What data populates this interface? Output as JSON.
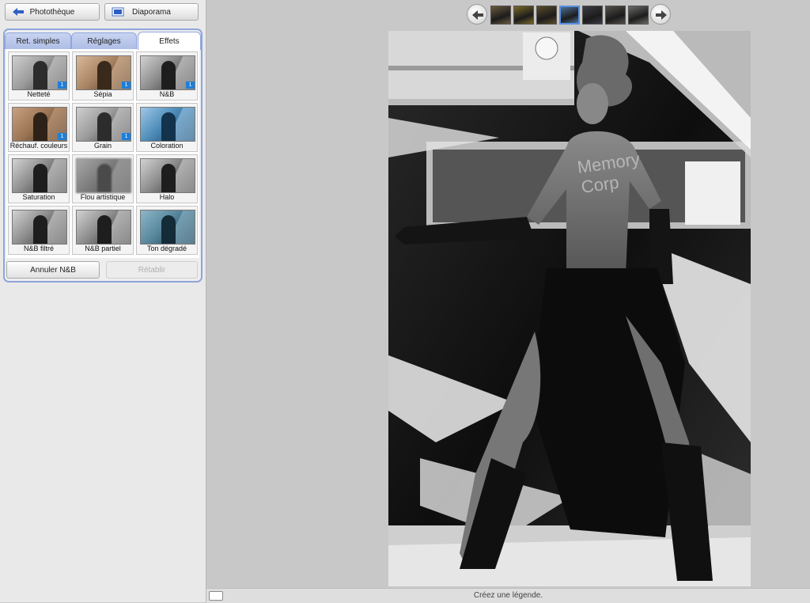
{
  "toolbar": {
    "phototheque_label": "Photothèque",
    "diaporama_label": "Diaporama"
  },
  "tabs": [
    {
      "label": "Ret. simples",
      "active": false
    },
    {
      "label": "Réglages",
      "active": false
    },
    {
      "label": "Effets",
      "active": true
    }
  ],
  "effects": [
    {
      "label": "Netteté",
      "tone": "gray",
      "badge": "1"
    },
    {
      "label": "Sépia",
      "tone": "sepia",
      "badge": "1"
    },
    {
      "label": "N&B",
      "tone": "bw",
      "badge": "1"
    },
    {
      "label": "Réchauf. couleurs",
      "tone": "warm",
      "badge": "1"
    },
    {
      "label": "Grain",
      "tone": "gray",
      "badge": "1"
    },
    {
      "label": "Coloration",
      "tone": "blue",
      "badge": ""
    },
    {
      "label": "Saturation",
      "tone": "bw",
      "badge": ""
    },
    {
      "label": "Flou artistique",
      "tone": "blur",
      "badge": ""
    },
    {
      "label": "Halo",
      "tone": "bw",
      "badge": ""
    },
    {
      "label": "N&B filtré",
      "tone": "bw",
      "badge": ""
    },
    {
      "label": "N&B partiel",
      "tone": "bw",
      "badge": ""
    },
    {
      "label": "Ton dégradé",
      "tone": "teal",
      "badge": ""
    }
  ],
  "actions": {
    "undo_label": "Annuler N&B",
    "redo_label": "Rétablir"
  },
  "filmstrip": {
    "thumbnails": [
      "#6b5a3e",
      "#7a6a2a",
      "#5c4d2a",
      "#4c6f96",
      "#3b3b46",
      "#55504a",
      "#6c6b68"
    ],
    "selected_index": 3
  },
  "caption": {
    "text": "Créez une légende."
  },
  "colors": {
    "accent": "#8fa5dc",
    "badge": "#1e7fd8"
  },
  "icons": {
    "phototheque": "back-arrow-icon",
    "diaporama": "slideshow-icon",
    "prev": "left-arrow-icon",
    "next": "right-arrow-icon",
    "caption": "caption-icon"
  }
}
